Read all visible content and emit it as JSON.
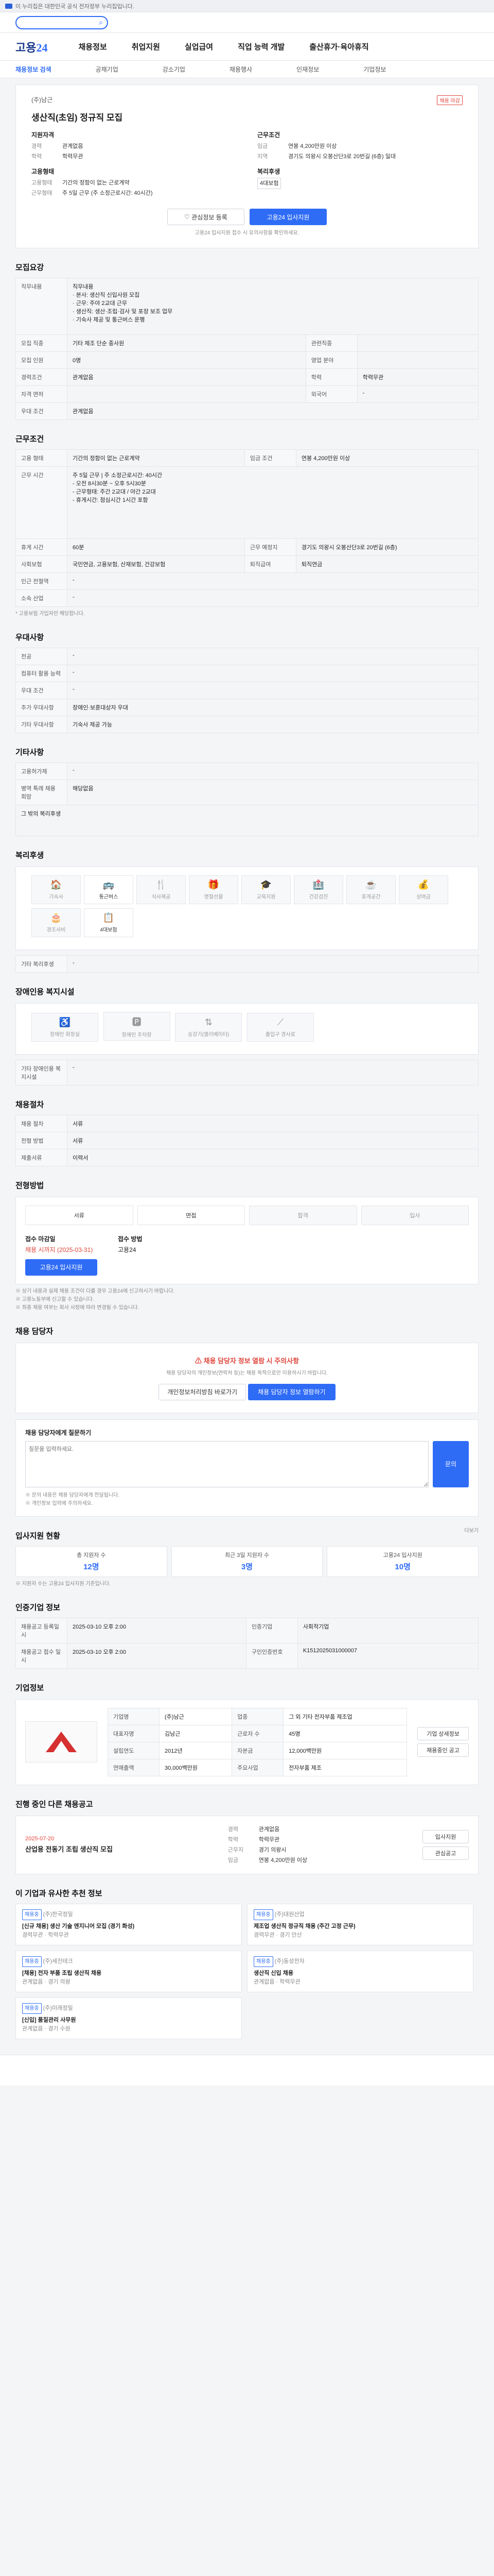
{
  "topbar": {
    "notice": "이 누리집은 대한민국 공식 전자정부 누리집입니다."
  },
  "search": {
    "icon": "search-icon"
  },
  "header": {
    "logo_a": "고용",
    "logo_b": "24",
    "menu": [
      "채용정보",
      "취업지원",
      "실업급여",
      "직업 능력 개발",
      "출산휴가·육아휴직"
    ]
  },
  "subnav": {
    "items": [
      "채용정보 검색",
      "공채기업",
      "강소기업",
      "채용행사",
      "인재정보",
      "기업정보",
      "기업정보"
    ]
  },
  "job": {
    "company": "(주)남근",
    "badge": "채용 마감",
    "title": "생산직(초임) 정규직 모집",
    "left_h": "지원자격",
    "left": [
      {
        "k": "경력",
        "v": "관계없음"
      },
      {
        "k": "학력",
        "v": "학력무관"
      }
    ],
    "right_h": "근무조건",
    "right": [
      {
        "k": "임금",
        "v": "연봉 4,200만원 이상"
      },
      {
        "k": "지역",
        "v": "경기도 의왕시 오봉산단3로 20번길 (6층) 일대"
      }
    ],
    "mid_left_h": "고용형태",
    "mid_left": [
      {
        "k": "고용형태",
        "v": "기간의 정함이 없는 근로계약"
      },
      {
        "k": "근무형태",
        "v": "주 5일 근무 (주 소정근로시간: 40시간)"
      }
    ],
    "mid_right_h": "복리후생",
    "mid_right": [
      {
        "k": "",
        "v": "4대보험"
      }
    ],
    "btn_scrap": "관심정보 등록",
    "btn_apply": "고용24 입사지원",
    "notice": "고용24 입사지원 접수 시 유의사항을 확인하세요."
  },
  "recruit": {
    "heading": "모집요강",
    "rows": [
      {
        "k": "직무내용",
        "v": "직무내용\n · 본사: 생산직 신입사원 모집\n · 근무: 주야 2교대 근무\n · 생산직: 생산·조립·검사 및 포장 보조 업무\n · 기숙사 제공 및 통근버스 운행"
      },
      {
        "k": "모집 직종",
        "v": "기타 제조 단순 종사원"
      },
      {
        "k": "관련직종",
        "v": ""
      },
      {
        "k": "모집 인원",
        "v": "0명"
      },
      {
        "k": "영업 분야",
        "v": ""
      },
      {
        "k": "경력조건",
        "v": "관계없음"
      },
      {
        "k": "학력",
        "v": "학력무관"
      },
      {
        "k": "자격 면허",
        "v": ""
      },
      {
        "k": "외국어",
        "v": "-"
      },
      {
        "k": "우대 조건",
        "v": "관계없음"
      }
    ]
  },
  "cond": {
    "heading": "근무조건",
    "rows": [
      {
        "k": "고용 형태",
        "v": "기간의 정함이 없는 근로계약"
      },
      {
        "k": "임금 조건",
        "v": "연봉 4,200만원 이상"
      },
      {
        "k": "근무 시간",
        "v": "주 5일 근무 | 주 소정근로시간: 40시간\n- 오전 8시30분 ~ 오후 5시30분\n- 근무형태: 주간 2교대 / 야간 2교대\n- 휴게시간: 점심시간 1시간 포함"
      },
      {
        "k": "휴게 시간",
        "v": "60분"
      },
      {
        "k": "근무 예정지",
        "v": "경기도 의왕시 오봉산단3로 20번길 (6층)"
      },
      {
        "k": "사회보험",
        "v": "국민연금, 고용보험, 산재보험, 건강보험"
      },
      {
        "k": "퇴직급여",
        "v": "퇴직연금"
      },
      {
        "k": "인근 전철역",
        "v": "-"
      },
      {
        "k": "소속 산업",
        "v": "-"
      }
    ],
    "note": "* 고용보험 가입자만 해당합니다."
  },
  "apply": {
    "heading": "우대사항",
    "rows": [
      {
        "k": "전공",
        "v": "-"
      },
      {
        "k": "컴퓨터 활용 능력",
        "v": "-"
      },
      {
        "k": "우대 조건",
        "v": "-"
      },
      {
        "k": "추가 우대사항",
        "v": "장애인·보훈대상자 우대"
      },
      {
        "k": "기타 우대사항",
        "v": "기숙사 제공 가능"
      }
    ]
  },
  "etc": {
    "heading": "기타사항",
    "rows": [
      {
        "k": "고용허가제",
        "v": "-"
      },
      {
        "k": "병역 특례 채용 희망",
        "v": "해당없음"
      }
    ],
    "more": "그 밖의 복리후생"
  },
  "welfare": {
    "heading": "복리후생",
    "items": [
      {
        "ic": "🏠",
        "t": "기숙사"
      },
      {
        "ic": "🚌",
        "t": "통근버스"
      },
      {
        "ic": "🍴",
        "t": "식사제공"
      },
      {
        "ic": "🎁",
        "t": "명절선물"
      },
      {
        "ic": "🎓",
        "t": "교육지원"
      },
      {
        "ic": "🏥",
        "t": "건강검진"
      },
      {
        "ic": "☕",
        "t": "휴게공간"
      },
      {
        "ic": "💰",
        "t": "상여금"
      },
      {
        "ic": "🎂",
        "t": "경조사비"
      },
      {
        "ic": "📋",
        "t": "4대보험"
      }
    ],
    "sub": "기타 복리후생"
  },
  "barrier": {
    "heading": "장애인용 복지시설",
    "items": [
      "장애인 화장실",
      "장애인 주차장",
      "승강기(엘리베이터)",
      "출입구 경사로"
    ],
    "sub": "기타 장애인용 복지시설"
  },
  "company": {
    "heading": "채용절차",
    "rows": [
      {
        "k": "채용 절차",
        "v": "서류"
      },
      {
        "k": "전형 방법",
        "v": "서류"
      },
      {
        "k": "제출서류",
        "v": "이력서"
      }
    ]
  },
  "process": {
    "heading": "전형방법",
    "steps": [
      "서류",
      "면접",
      "합격",
      "입사"
    ],
    "apply_h": "접수 마감일",
    "apply_v": "채용 시까지 (2025-03-31)",
    "method_h": "접수 방법",
    "method_v": "고용24",
    "apply_btn": "고용24 입사지원",
    "notes": [
      "※ 상기 내용과 실제 채용 조건이 다를 경우 고용24에 신고하시기 바랍니다.",
      "※ 고용노동부에 신고할 수 있습니다.",
      "※ 최종 채용 여부는 회사 사정에 따라 변경될 수 있습니다."
    ]
  },
  "manager": {
    "heading": "채용 담당자",
    "warn": "채용 담당자 정보 열람 시 주의사항",
    "desc": "채용 담당자의 개인정보(연락처 등)는 채용 목적으로만 이용하시기 바랍니다.",
    "b1": "개인정보처리방침 바로가기",
    "b2": "채용 담당자 정보 열람하기"
  },
  "contact": {
    "heading": "채용 담당자에게 질문하기",
    "placeholder": "질문을 입력하세요.",
    "send": "문의",
    "notes": [
      "※ 문의 내용은 채용 담당자에게 전달됩니다.",
      "※ 개인정보 입력에 주의하세요."
    ]
  },
  "stats": {
    "heading": "입사지원 현황",
    "more": "더보기",
    "items": [
      {
        "k": "총 지원자 수",
        "v": "12명"
      },
      {
        "k": "최근 3일 지원자 수",
        "v": "3명"
      },
      {
        "k": "고용24 입사지원",
        "v": "10명"
      }
    ],
    "note": "※ 지원자 수는 고용24 입사지원 기준입니다."
  },
  "info": {
    "heading": "인증기업 정보",
    "rows": [
      {
        "k": "채용공고 등록일시",
        "v": "2025-03-10 오후 2:00"
      },
      {
        "k": "인증기업",
        "v": "사회적기업"
      },
      {
        "k": "채용공고 접수 일시",
        "v": "2025-03-10 오후 2:00"
      },
      {
        "k": "구인인증번호",
        "v": "K1512025031000007"
      }
    ],
    "btn": "기업 정보"
  },
  "corp": {
    "heading": "기업정보",
    "name": "(주)남근",
    "rows": [
      {
        "k": "기업명",
        "v": "(주)남근"
      },
      {
        "k": "업종",
        "v": "그 외 기타 전자부품 제조업"
      },
      {
        "k": "대표자명",
        "v": "김남근"
      },
      {
        "k": "근로자 수",
        "v": "45명"
      },
      {
        "k": "설립연도",
        "v": "2012년"
      },
      {
        "k": "자본금",
        "v": "12,000백만원"
      },
      {
        "k": "연매출액",
        "v": "30,000백만원"
      },
      {
        "k": "주요사업",
        "v": "전자부품 제조"
      }
    ],
    "b1": "기업 상세정보",
    "b2": "채용중인 공고"
  },
  "similar": {
    "heading": "진행 중인 다른 채용공고",
    "date": "2025-07-20",
    "title": "산업용 전동기 조립 생산직 모집",
    "items": [
      {
        "k": "경력",
        "v": "관계없음"
      },
      {
        "k": "학력",
        "v": "학력무관"
      },
      {
        "k": "근무지",
        "v": "경기 의왕시"
      },
      {
        "k": "임금",
        "v": "연봉 4,200만원 이상"
      }
    ],
    "b1": "입사지원",
    "b2": "관심공고"
  },
  "recommend": {
    "heading": "이 기업과 유사한 추천 정보",
    "cards": [
      {
        "tag": "채용중",
        "company": "(주)한국정밀",
        "title": "[신규 채용] 생산 기술 엔지니어 모집 (경기 화성)",
        "meta": [
          "경력무관",
          "학력무관"
        ]
      },
      {
        "tag": "채용중",
        "company": "(주)대원산업",
        "title": "제조업 생산직 정규직 채용 (주간 고정 근무)",
        "meta": [
          "경력무관",
          "경기 안산"
        ]
      },
      {
        "tag": "채용중",
        "company": "(주)세진테크",
        "title": "[채용] 전자 부품 조립 생산직 채용",
        "meta": [
          "관계없음",
          "경기 의왕"
        ]
      },
      {
        "tag": "채용중",
        "company": "(주)동성전자",
        "title": "생산직 신입 채용",
        "meta": [
          "관계없음",
          "학력무관"
        ]
      },
      {
        "tag": "채용중",
        "company": "(주)미래정밀",
        "title": "[신입] 품질관리 사무원",
        "meta": [
          "관계없음",
          "경기 수원"
        ]
      }
    ]
  }
}
